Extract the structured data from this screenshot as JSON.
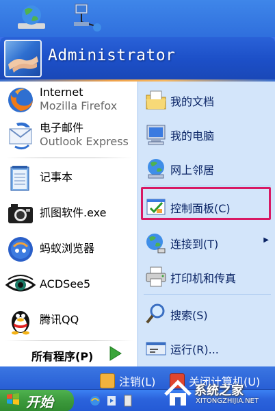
{
  "header": {
    "username": "Administrator"
  },
  "left_items": [
    {
      "title": "Internet",
      "subtitle": "Mozilla Firefox",
      "icon": "firefox-icon"
    },
    {
      "title": "电子邮件",
      "subtitle": "Outlook Express",
      "icon": "outlook-express-icon"
    },
    {
      "title": "记事本",
      "icon": "notepad-icon"
    },
    {
      "title": "抓图软件.exe",
      "icon": "camera-icon"
    },
    {
      "title": "蚂蚁浏览器",
      "icon": "ant-browser-icon"
    },
    {
      "title": "ACDSee5",
      "icon": "acdsee-eye-icon"
    },
    {
      "title": "腾讯QQ",
      "icon": "qq-penguin-icon"
    }
  ],
  "all_programs": "所有程序(P)",
  "right_items": [
    {
      "label": "我的文档",
      "icon": "my-documents-icon"
    },
    {
      "label": "我的电脑",
      "icon": "my-computer-icon"
    },
    {
      "label": "网上邻居",
      "icon": "network-places-icon"
    },
    {
      "label": "控制面板(C)",
      "icon": "control-panel-icon"
    },
    {
      "label": "连接到(T)",
      "icon": "connect-to-icon"
    },
    {
      "label": "打印机和传真",
      "icon": "printers-faxes-icon"
    },
    {
      "label": "搜索(S)",
      "icon": "search-icon"
    },
    {
      "label": "运行(R)...",
      "icon": "run-icon"
    }
  ],
  "bottom": {
    "logoff": "注销(L)",
    "shutdown": "关闭计算机(U)"
  },
  "taskbar": {
    "start": "开始"
  },
  "watermark": {
    "text": "系统之家",
    "url": "XITONGZHIJIA.NET"
  },
  "colors": {
    "highlight_border": "#d81963",
    "header_blue": "#1c4fc7",
    "right_panel": "#d3e5fa"
  }
}
